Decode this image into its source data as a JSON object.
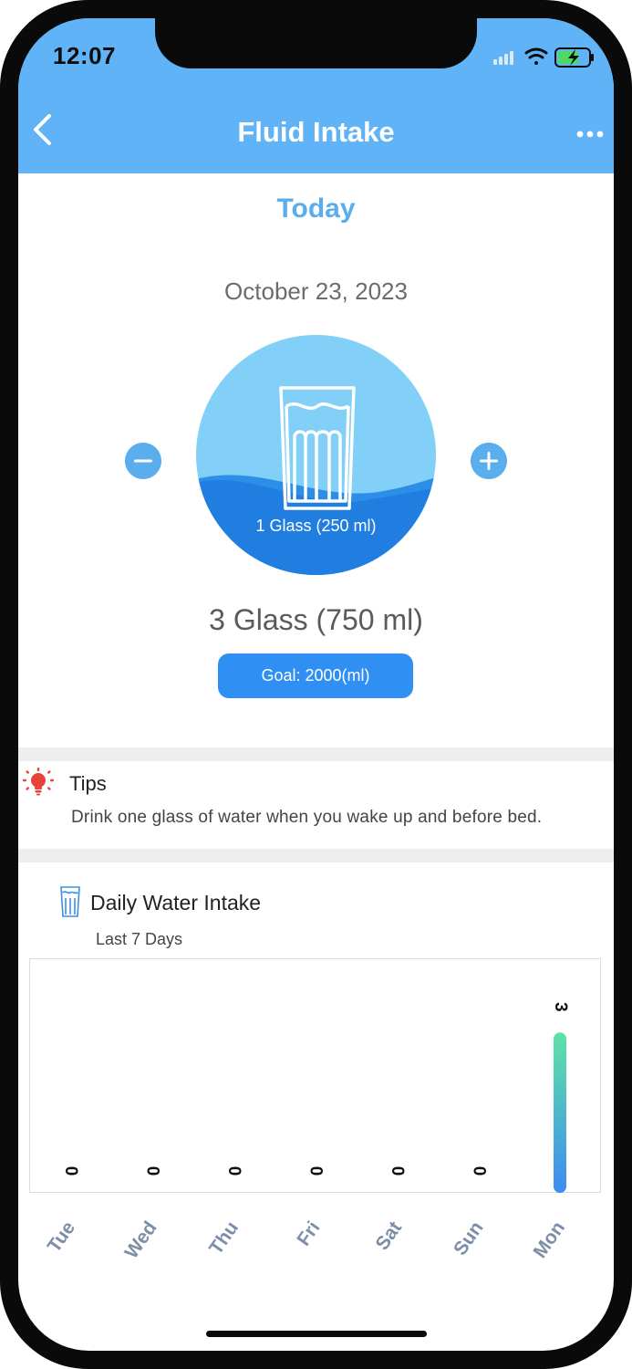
{
  "status_bar": {
    "time": "12:07"
  },
  "nav": {
    "title": "Fluid Intake",
    "back_icon": "chevron-left-icon",
    "more_icon": "ellipsis-icon"
  },
  "today_label": "Today",
  "date": "October 23, 2023",
  "glass_display": {
    "label": "1 Glass (250 ml)",
    "icon": "water-glass-icon"
  },
  "total": "3 Glass (750 ml)",
  "goal": "Goal: 2000(ml)",
  "tips": {
    "title": "Tips",
    "text": "Drink one glass of water when you wake up and before bed.",
    "icon": "lightbulb-icon"
  },
  "colors": {
    "header": "#5fb3f6",
    "accent": "#5aaeee",
    "goal_button": "#2f8ff3",
    "circle_light": "#82cff7",
    "circle_dark": "#1f7ee0",
    "bar_top": "#5ee3a6",
    "bar_bottom": "#3d8bf2"
  },
  "chart_data": {
    "type": "bar",
    "title": "Daily Water Intake",
    "subtitle": "Last 7 Days",
    "categories": [
      "Tue",
      "Wed",
      "Thu",
      "Fri",
      "Sat",
      "Sun",
      "Mon"
    ],
    "values": [
      0,
      0,
      0,
      0,
      0,
      0,
      3
    ],
    "ylim": [
      0,
      3.5
    ],
    "grid": false,
    "data_labels": true,
    "value_unit": "glasses"
  }
}
